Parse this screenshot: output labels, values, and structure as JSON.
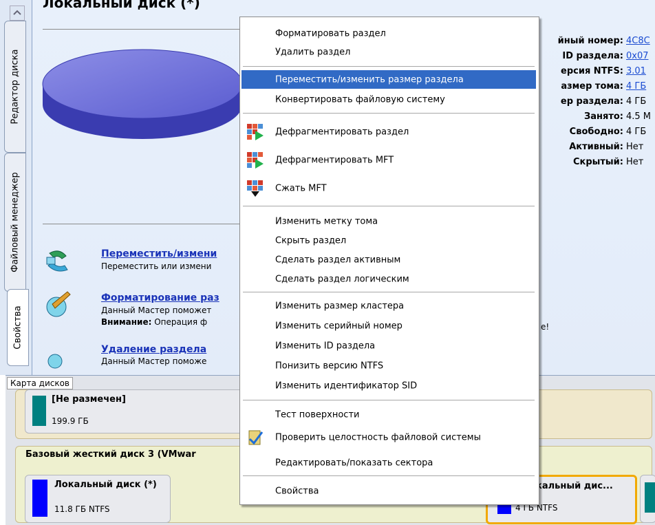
{
  "tabs": {
    "disk_editor": "Редактор диска",
    "file_manager": "Файловый менеджер",
    "properties": "Свойства"
  },
  "main": {
    "disk_title": "Локальный диск (*)",
    "properties": [
      {
        "label": "йный номер:",
        "value": "4C8C",
        "link": true
      },
      {
        "label": "ID раздела:",
        "value": "0x07",
        "link": true
      },
      {
        "label": "ерсия NTFS:",
        "value": "3.01",
        "link": true
      },
      {
        "label": "азмер тома:",
        "value": "4 ГБ",
        "link": true
      },
      {
        "label": "ер раздела:",
        "value": "4 ГБ",
        "link": false
      },
      {
        "label": "Занято:",
        "value": "4.5 M",
        "link": false
      },
      {
        "label": "Свободно:",
        "value": "4 ГБ",
        "link": false
      },
      {
        "label": "Активный:",
        "value": "Нет",
        "link": false
      },
      {
        "label": "Скрытый:",
        "value": "Нет",
        "link": false
      }
    ],
    "tasks": [
      {
        "title": "Переместить/измени",
        "desc": "Переместить или измени"
      },
      {
        "title": "Форматирование раз",
        "desc": "Данный Мастер поможет",
        "warning_bold": "Внимание:",
        "warning_text": "Операция ф",
        "warning_tail": "е!"
      },
      {
        "title": "Удаление раздела",
        "desc": "Данный Мастер поможе"
      }
    ]
  },
  "disk_map": {
    "label": "Карта дисков",
    "unallocated_name": "[Не размечен]",
    "unallocated_size": "199.9 ГБ",
    "disk3_title": "Базовый жесткий диск 3 (VMwar",
    "part1_name": "Локальный диск (*)",
    "part1_size": "11.8 ГБ NTFS",
    "part2_name": "кальный дис...",
    "part2_size": "4 ГБ NTFS",
    "colors": {
      "unallocated": "#008080",
      "ntfs": "#0000ff",
      "selected_border": "#f2a900"
    }
  },
  "context_menu": {
    "items": [
      {
        "label": "Форматировать раздел"
      },
      {
        "label": "Удалить раздел"
      },
      {
        "label": "Переместить/изменить размер раздела",
        "highlighted": true
      },
      {
        "label": "Конвертировать файловую систему"
      },
      {
        "label": "Дефрагментировать раздел",
        "icon": "defrag-icon"
      },
      {
        "label": "Дефрагментировать MFT",
        "icon": "defrag-mft-icon"
      },
      {
        "label": "Сжать MFT",
        "icon": "compress-mft-icon"
      },
      {
        "label": "Изменить метку тома"
      },
      {
        "label": "Скрыть раздел"
      },
      {
        "label": "Сделать раздел активным"
      },
      {
        "label": "Сделать раздел логическим"
      },
      {
        "label": "Изменить размер кластера"
      },
      {
        "label": "Изменить серийный номер"
      },
      {
        "label": "Изменить ID раздела"
      },
      {
        "label": "Понизить версию NTFS"
      },
      {
        "label": "Изменить идентификатор SID"
      },
      {
        "label": "Тест поверхности"
      },
      {
        "label": "Проверить целостность файловой системы",
        "icon": "check-fs-icon"
      },
      {
        "label": "Редактировать/показать сектора"
      },
      {
        "label": "Свойства"
      }
    ],
    "highlight_color": "#316ac5"
  }
}
